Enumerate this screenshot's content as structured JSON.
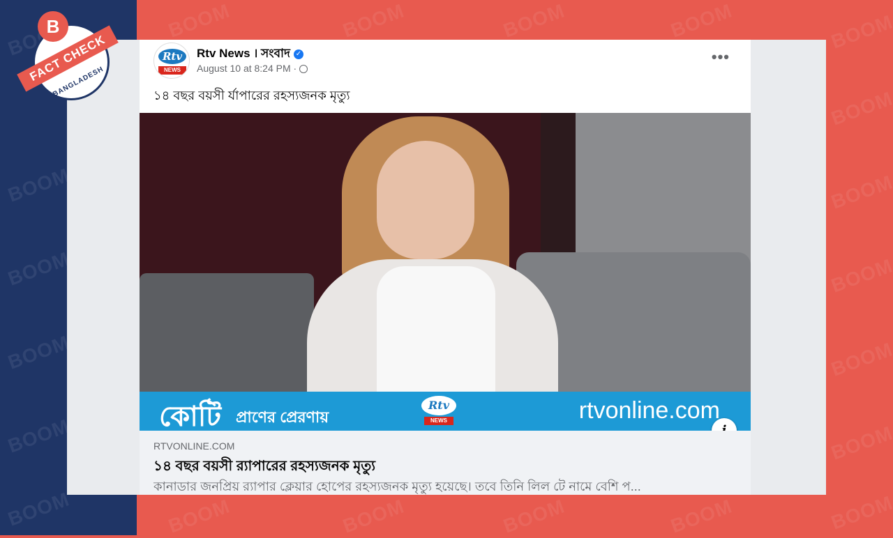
{
  "page": {
    "watermark_text": "BOOM"
  },
  "badge": {
    "letter": "B",
    "ribbon": "FACT CHECK",
    "country": "BANGLADESH"
  },
  "post": {
    "author": "Rtv News । সংবাদ",
    "avatar_logo_top": "Rtv",
    "avatar_logo_bottom": "NEWS",
    "date": "August 10 at 8:24 PM ·",
    "more_label": "•••",
    "text": "১৪ বছর বয়সী র্যাপারের রহস্যজনক মৃত্যু",
    "image": {
      "description_icon": "photo",
      "banner_main": "কোটি",
      "banner_sub": "প্রাণের প্রেরণায়",
      "banner_logo_top": "Rtv",
      "banner_logo_bottom": "NEWS",
      "banner_url": "rtvonline.com"
    },
    "info_button": "i",
    "link": {
      "domain": "RTVONLINE.COM",
      "title": "১৪ বছর বয়সী র‍্যাপারের রহস্যজনক মৃত্যু",
      "description": "কানাডার জনপ্রিয় র‍্যাপার ক্লেয়ার হোপের রহস্যজনক মৃত্যু হয়েছে। তবে তিনি লিল টে নামে বেশি প..."
    }
  },
  "colors": {
    "left_bg": "#1f3566",
    "right_bg": "#e85a4f",
    "banner_blue": "#1d9ad6",
    "verified_blue": "#1877f2"
  }
}
